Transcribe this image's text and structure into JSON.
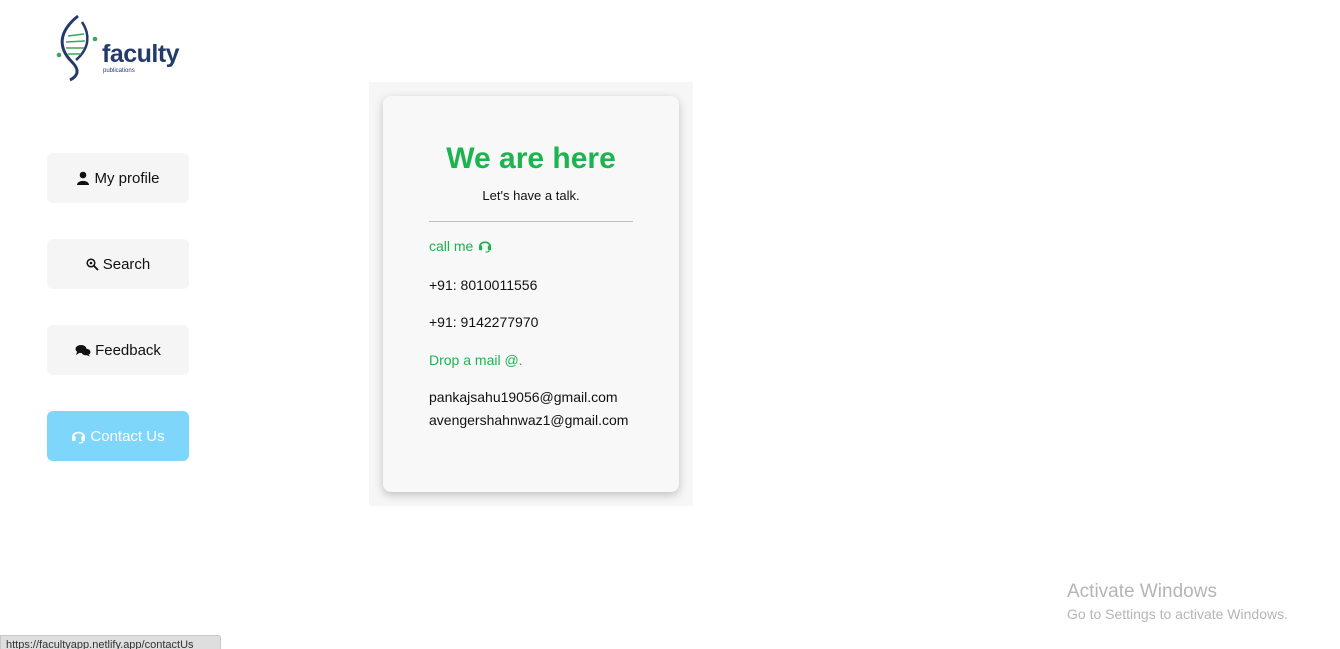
{
  "logo": {
    "name": "faculty",
    "tagline": "publications"
  },
  "sidebar": {
    "items": [
      {
        "label": "My profile",
        "icon": "user-icon",
        "active": false
      },
      {
        "label": "Search",
        "icon": "search-icon",
        "active": false
      },
      {
        "label": "Feedback",
        "icon": "comments-icon",
        "active": false
      },
      {
        "label": "Contact Us",
        "icon": "headset-icon",
        "active": true
      }
    ]
  },
  "card": {
    "title": "We are here",
    "subtitle": "Let's have a talk.",
    "call_label": "call me",
    "phones": [
      "+91: 8010011556",
      "+91: 9142277970"
    ],
    "mail_label": "Drop a mail @.",
    "emails": [
      "pankajsahu19056@gmail.com",
      "avengershahnwaz1@gmail.com"
    ]
  },
  "watermark": {
    "title": "Activate Windows",
    "subtitle": "Go to Settings to activate Windows."
  },
  "statusbar": {
    "url": "https://facultyapp.netlify.app/contactUs"
  },
  "colors": {
    "accent_green": "#1db34f",
    "active_nav": "#7fd6fb",
    "logo_navy": "#233a6b"
  }
}
